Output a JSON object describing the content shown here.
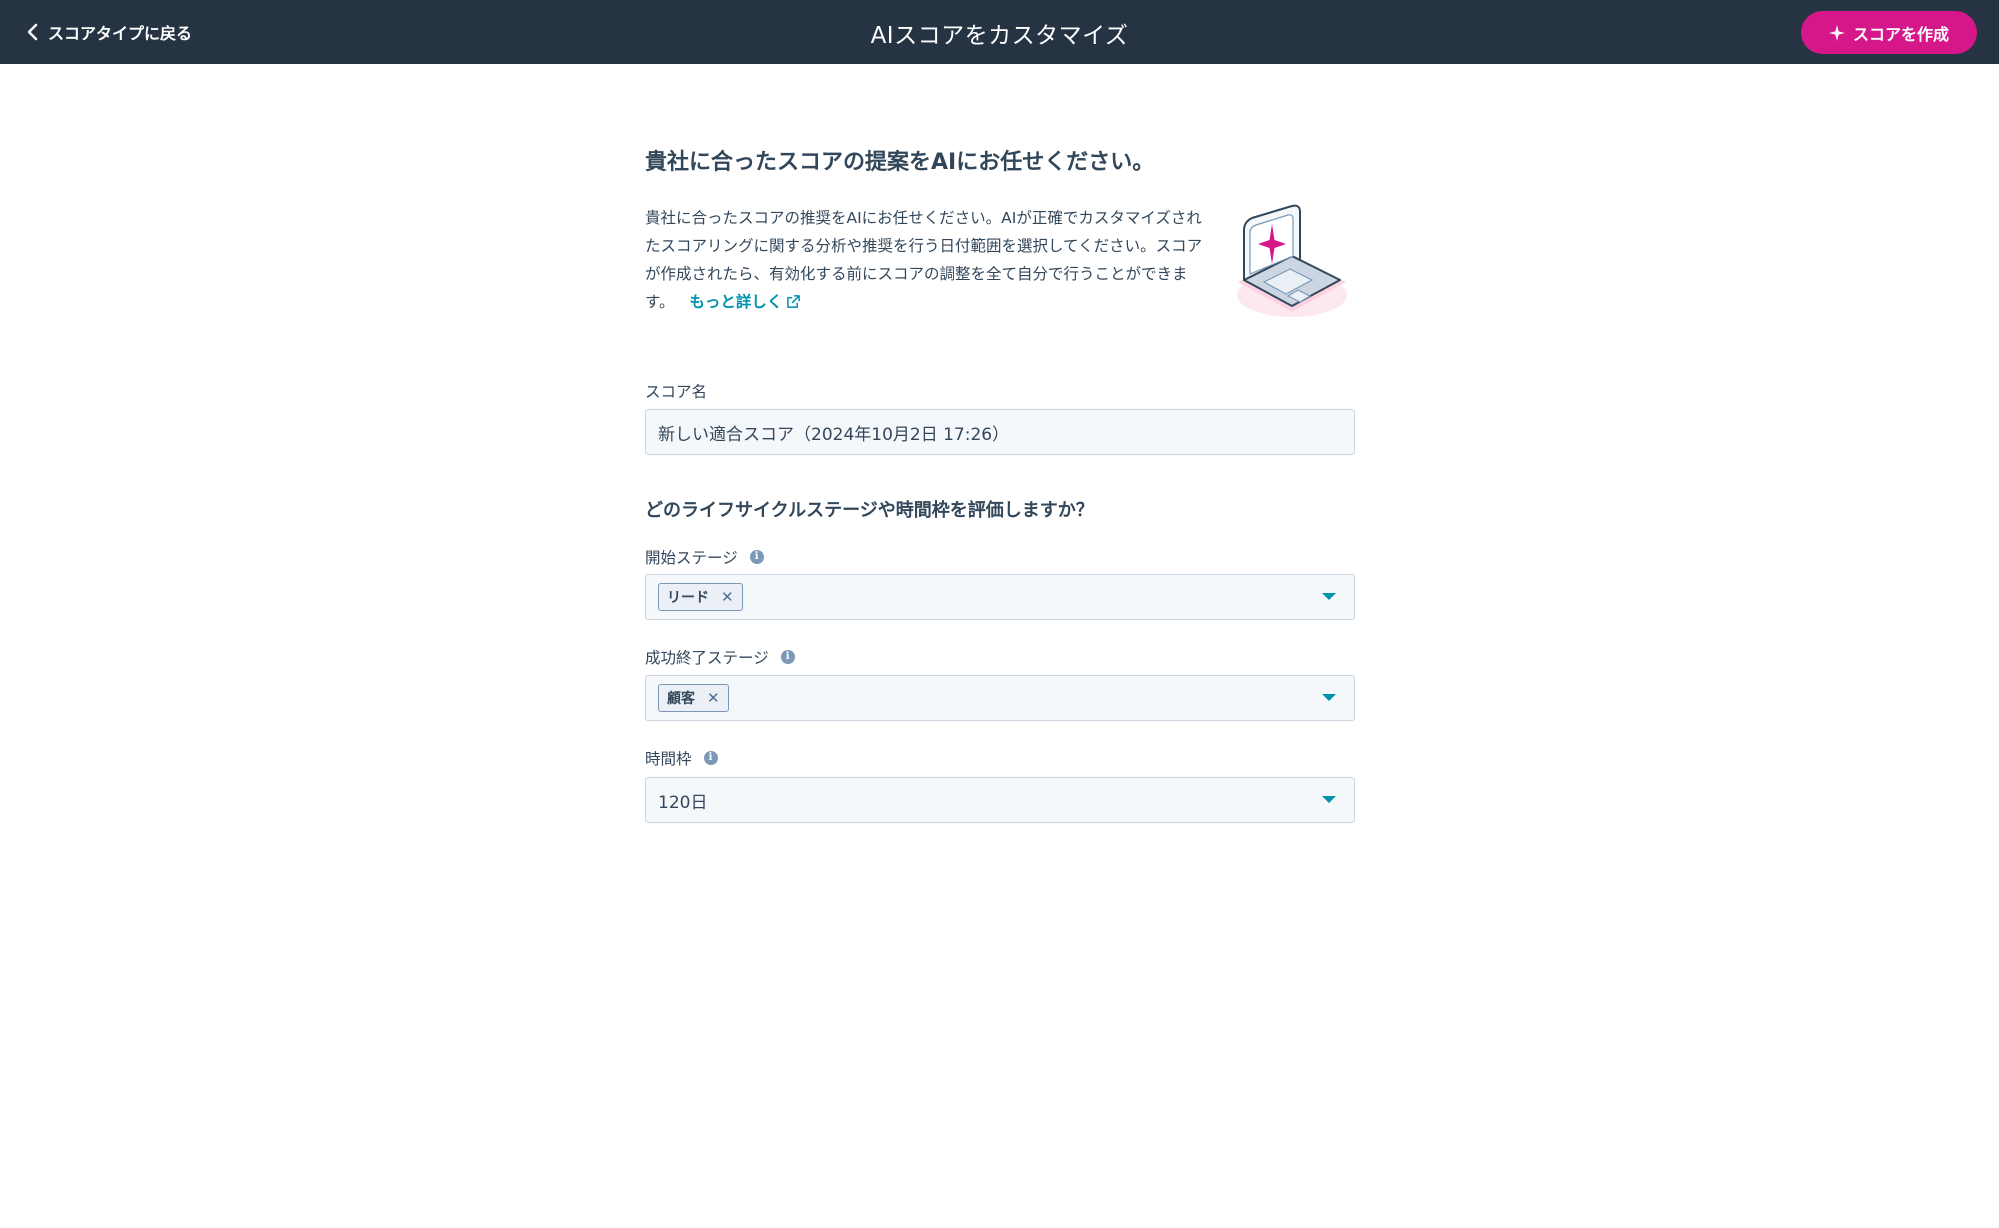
{
  "header": {
    "back_label": "スコアタイプに戻る",
    "title": "AIスコアをカスタマイズ",
    "create_label": "スコアを作成"
  },
  "intro": {
    "heading": "貴社に合ったスコアの提案をAIにお任せください。",
    "description": "貴社に合ったスコアの推奨をAIにお任せください。AIが正確でカスタマイズされたスコアリングに関する分析や推奨を行う日付範囲を選択してください。スコアが作成されたら、有効化する前にスコアの調整を全て自分で行うことができます。",
    "learn_more": "もっと詳しく"
  },
  "score_name": {
    "label": "スコア名",
    "value": "新しい適合スコア（2024年10月2日 17:26）"
  },
  "evaluation": {
    "question": "どのライフサイクルステージや時間枠を評価しますか？",
    "start_stage": {
      "label": "開始ステージ",
      "tag": "リード"
    },
    "success_stage": {
      "label": "成功終了ステージ",
      "tag": "顧客"
    },
    "timeframe": {
      "label": "時間枠",
      "value": "120日"
    }
  },
  "colors": {
    "header_bg": "#253342",
    "accent": "#d6178a",
    "link": "#0091ae",
    "text": "#33475b"
  }
}
